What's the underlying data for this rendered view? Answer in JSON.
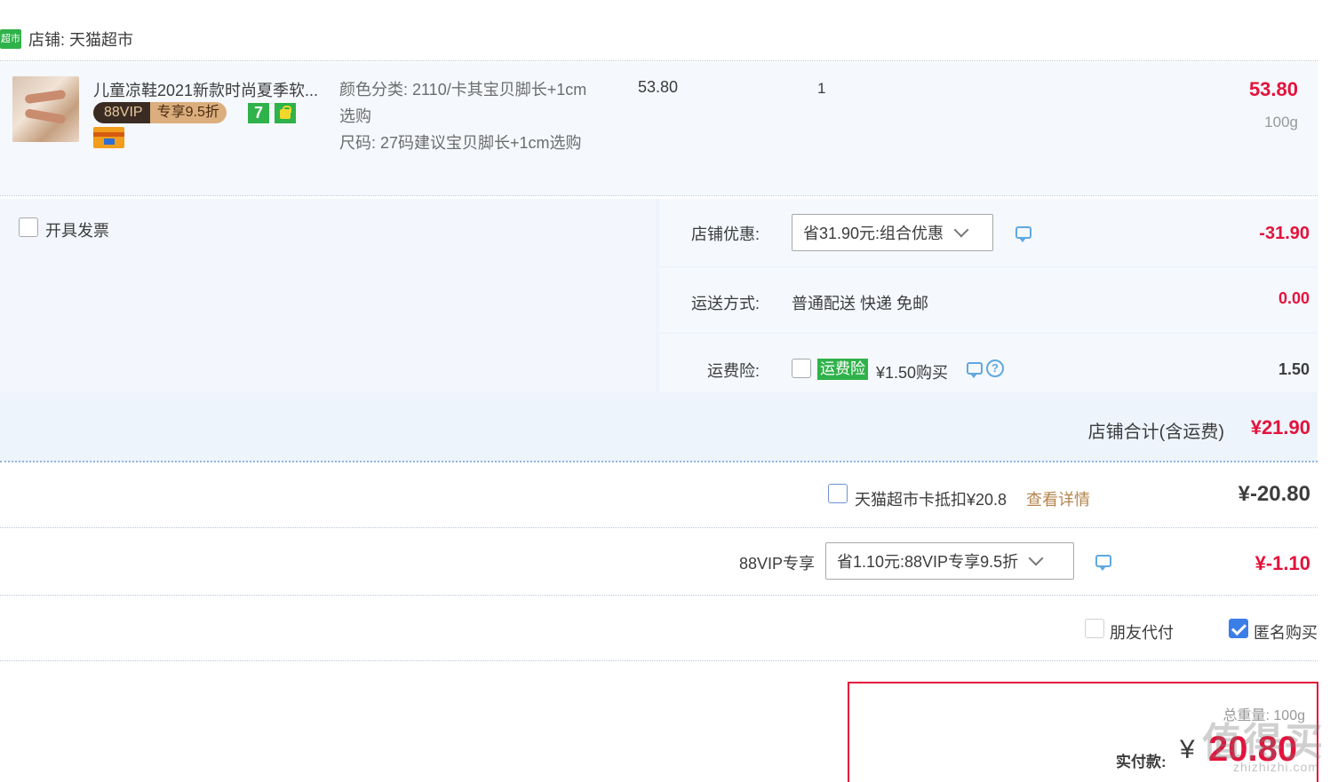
{
  "shop": {
    "logo_text": "超市",
    "label": "店铺: 天猫超市"
  },
  "item": {
    "title": "儿童凉鞋2021新款时尚夏季软...",
    "vip_left": "88VIP",
    "vip_right": "专享9.5折",
    "seven_icon": "7",
    "sku_color": "颜色分类: 2110/卡其宝贝脚长+1cm选购",
    "sku_size": "尺码: 27码建议宝贝脚长+1cm选购",
    "unit_price": "53.80",
    "quantity": "1",
    "line_total": "53.80",
    "weight": "100g"
  },
  "invoice": {
    "label": "开具发票",
    "checked": false
  },
  "shop_discount": {
    "label": "店铺优惠:",
    "select_value": "省31.90元:组合优惠",
    "amount": "-31.90"
  },
  "shipping": {
    "label": "运送方式:",
    "value": "普通配送 快递 免邮",
    "amount": "0.00"
  },
  "insurance": {
    "label": "运费险:",
    "tag": "运费险",
    "price": "¥1.50购买",
    "amount": "1.50",
    "help": "?"
  },
  "shop_total": {
    "label": "店铺合计(含运费)",
    "amount": "¥21.90"
  },
  "card_deduct": {
    "label": "天猫超市卡抵扣¥20.8",
    "link": "查看详情",
    "amount": "¥-20.80"
  },
  "vip": {
    "label": "88VIP专享",
    "select_value": "省1.10元:88VIP专享9.5折",
    "amount": "¥-1.10"
  },
  "friend_pay": {
    "label": "朋友代付",
    "checked": false
  },
  "anonymous": {
    "label": "匿名购买",
    "checked": true
  },
  "pay": {
    "weight_label": "总重量: 100g",
    "actual_label": "实付款:",
    "currency": "¥",
    "amount": "20.80"
  },
  "watermark": {
    "main": "值得买",
    "sub": "zhizhizhi.com"
  },
  "colors": {
    "accent_red": "#e4123b",
    "tmall_green": "#2fb24a",
    "link_blue": "#5fa8e0"
  }
}
